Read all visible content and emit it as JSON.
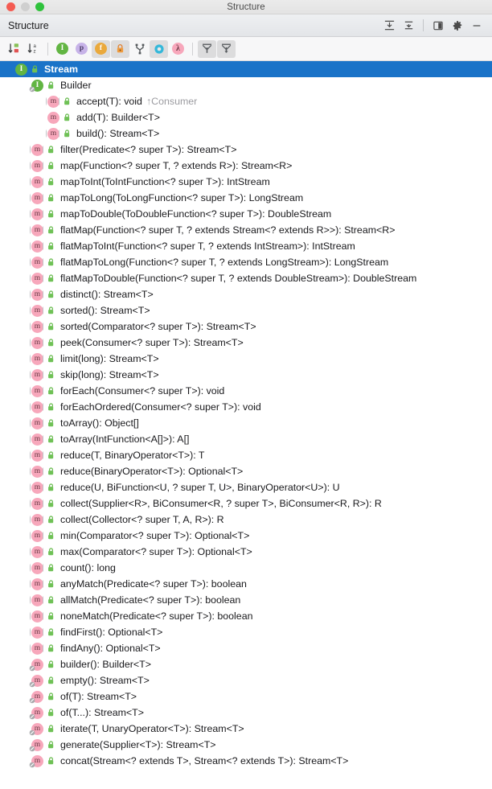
{
  "window": {
    "title": "Structure",
    "traffic_lights": [
      "close-button",
      "minimize-button",
      "zoom-button"
    ]
  },
  "panel": {
    "title": "Structure",
    "actions": [
      {
        "name": "expand-all-button",
        "icon": "expand-all-icon",
        "tooltip": "Expand All"
      },
      {
        "name": "collapse-all-button",
        "icon": "collapse-all-icon",
        "tooltip": "Collapse All"
      },
      {
        "name": "view-mode-button",
        "icon": "panel-layout-icon",
        "tooltip": "View Mode"
      },
      {
        "name": "settings-button",
        "icon": "gear-icon",
        "tooltip": "Settings"
      },
      {
        "name": "hide-button",
        "icon": "minimize-dash-icon",
        "tooltip": "Hide"
      }
    ]
  },
  "toolbar": {
    "buttons": [
      {
        "name": "sort-by-visibility-button",
        "icon": "sort-by-visibility-icon",
        "active": false
      },
      {
        "name": "sort-alphabetically-button",
        "icon": "sort-alphabetically-icon",
        "active": false
      },
      {
        "name": "show-inherited-button",
        "icon": "inherited-members-icon",
        "glyph": "I",
        "color": "#62b543",
        "active": false
      },
      {
        "name": "show-properties-button",
        "icon": "properties-icon",
        "glyph": "p",
        "color": "#b39ddb",
        "active": false
      },
      {
        "name": "show-fields-button",
        "icon": "fields-icon",
        "glyph": "f",
        "color": "#e8a33d",
        "active": true
      },
      {
        "name": "show-non-public-button",
        "icon": "lock-icon",
        "color": "#e8833a",
        "active": true
      },
      {
        "name": "group-by-implementation-button",
        "icon": "group-by-implementation-icon",
        "active": false
      },
      {
        "name": "show-interfaces-button",
        "icon": "interface-ring-icon",
        "color": "#3bb6d6",
        "active": true
      },
      {
        "name": "show-lambdas-button",
        "icon": "lambda-icon",
        "glyph": "λ",
        "color": "#f7a7bb",
        "active": false
      },
      {
        "name": "scroll-from-source-button",
        "icon": "scroll-from-source-icon",
        "active": true
      },
      {
        "name": "scroll-to-source-button",
        "icon": "scroll-to-source-icon",
        "active": true
      }
    ]
  },
  "tree": {
    "rows": [
      {
        "indent": 0,
        "twisty": "down",
        "icon": "interface-icon",
        "glyph": "I",
        "vis": "public-lock-icon",
        "label": "Stream",
        "owner": "",
        "selected": true
      },
      {
        "indent": 1,
        "twisty": "down",
        "icon": "interface-static-icon",
        "glyph": "I",
        "vis": "public-lock-icon",
        "label": "Builder",
        "owner": "",
        "selected": false
      },
      {
        "indent": 2,
        "twisty": "none",
        "icon": "method-inherited-icon",
        "glyph": "m",
        "vis": "public-lock-icon",
        "label": "accept(T): void",
        "owner": "↑Consumer",
        "selected": false
      },
      {
        "indent": 2,
        "twisty": "none",
        "icon": "method-icon",
        "glyph": "m",
        "vis": "public-lock-icon",
        "label": "add(T): Builder<T>",
        "owner": "",
        "selected": false
      },
      {
        "indent": 2,
        "twisty": "none",
        "icon": "method-inherited-icon",
        "glyph": "m",
        "vis": "public-lock-icon",
        "label": "build(): Stream<T>",
        "owner": "",
        "selected": false
      },
      {
        "indent": 1,
        "twisty": "none",
        "icon": "method-inherited-icon",
        "glyph": "m",
        "vis": "public-lock-icon",
        "label": "filter(Predicate<? super T>): Stream<T>",
        "owner": "",
        "selected": false
      },
      {
        "indent": 1,
        "twisty": "none",
        "icon": "method-inherited-icon",
        "glyph": "m",
        "vis": "public-lock-icon",
        "label": "map(Function<? super T, ? extends R>): Stream<R>",
        "owner": "",
        "selected": false
      },
      {
        "indent": 1,
        "twisty": "none",
        "icon": "method-inherited-icon",
        "glyph": "m",
        "vis": "public-lock-icon",
        "label": "mapToInt(ToIntFunction<? super T>): IntStream",
        "owner": "",
        "selected": false
      },
      {
        "indent": 1,
        "twisty": "none",
        "icon": "method-inherited-icon",
        "glyph": "m",
        "vis": "public-lock-icon",
        "label": "mapToLong(ToLongFunction<? super T>): LongStream",
        "owner": "",
        "selected": false
      },
      {
        "indent": 1,
        "twisty": "none",
        "icon": "method-inherited-icon",
        "glyph": "m",
        "vis": "public-lock-icon",
        "label": "mapToDouble(ToDoubleFunction<? super T>): DoubleStream",
        "owner": "",
        "selected": false
      },
      {
        "indent": 1,
        "twisty": "none",
        "icon": "method-inherited-icon",
        "glyph": "m",
        "vis": "public-lock-icon",
        "label": "flatMap(Function<? super T, ? extends Stream<? extends R>>): Stream<R>",
        "owner": "",
        "selected": false
      },
      {
        "indent": 1,
        "twisty": "none",
        "icon": "method-inherited-icon",
        "glyph": "m",
        "vis": "public-lock-icon",
        "label": "flatMapToInt(Function<? super T, ? extends IntStream>): IntStream",
        "owner": "",
        "selected": false
      },
      {
        "indent": 1,
        "twisty": "none",
        "icon": "method-inherited-icon",
        "glyph": "m",
        "vis": "public-lock-icon",
        "label": "flatMapToLong(Function<? super T, ? extends LongStream>): LongStream",
        "owner": "",
        "selected": false
      },
      {
        "indent": 1,
        "twisty": "none",
        "icon": "method-inherited-icon",
        "glyph": "m",
        "vis": "public-lock-icon",
        "label": "flatMapToDouble(Function<? super T, ? extends DoubleStream>): DoubleStream",
        "owner": "",
        "selected": false
      },
      {
        "indent": 1,
        "twisty": "none",
        "icon": "method-inherited-icon",
        "glyph": "m",
        "vis": "public-lock-icon",
        "label": "distinct(): Stream<T>",
        "owner": "",
        "selected": false
      },
      {
        "indent": 1,
        "twisty": "none",
        "icon": "method-inherited-icon",
        "glyph": "m",
        "vis": "public-lock-icon",
        "label": "sorted(): Stream<T>",
        "owner": "",
        "selected": false
      },
      {
        "indent": 1,
        "twisty": "none",
        "icon": "method-inherited-icon",
        "glyph": "m",
        "vis": "public-lock-icon",
        "label": "sorted(Comparator<? super T>): Stream<T>",
        "owner": "",
        "selected": false
      },
      {
        "indent": 1,
        "twisty": "none",
        "icon": "method-inherited-icon",
        "glyph": "m",
        "vis": "public-lock-icon",
        "label": "peek(Consumer<? super T>): Stream<T>",
        "owner": "",
        "selected": false
      },
      {
        "indent": 1,
        "twisty": "none",
        "icon": "method-inherited-icon",
        "glyph": "m",
        "vis": "public-lock-icon",
        "label": "limit(long): Stream<T>",
        "owner": "",
        "selected": false
      },
      {
        "indent": 1,
        "twisty": "none",
        "icon": "method-inherited-icon",
        "glyph": "m",
        "vis": "public-lock-icon",
        "label": "skip(long): Stream<T>",
        "owner": "",
        "selected": false
      },
      {
        "indent": 1,
        "twisty": "none",
        "icon": "method-inherited-icon",
        "glyph": "m",
        "vis": "public-lock-icon",
        "label": "forEach(Consumer<? super T>): void",
        "owner": "",
        "selected": false
      },
      {
        "indent": 1,
        "twisty": "none",
        "icon": "method-inherited-icon",
        "glyph": "m",
        "vis": "public-lock-icon",
        "label": "forEachOrdered(Consumer<? super T>): void",
        "owner": "",
        "selected": false
      },
      {
        "indent": 1,
        "twisty": "none",
        "icon": "method-inherited-icon",
        "glyph": "m",
        "vis": "public-lock-icon",
        "label": "toArray(): Object[]",
        "owner": "",
        "selected": false
      },
      {
        "indent": 1,
        "twisty": "none",
        "icon": "method-inherited-icon",
        "glyph": "m",
        "vis": "public-lock-icon",
        "label": "toArray(IntFunction<A[]>): A[]",
        "owner": "",
        "selected": false
      },
      {
        "indent": 1,
        "twisty": "none",
        "icon": "method-inherited-icon",
        "glyph": "m",
        "vis": "public-lock-icon",
        "label": "reduce(T, BinaryOperator<T>): T",
        "owner": "",
        "selected": false
      },
      {
        "indent": 1,
        "twisty": "none",
        "icon": "method-inherited-icon",
        "glyph": "m",
        "vis": "public-lock-icon",
        "label": "reduce(BinaryOperator<T>): Optional<T>",
        "owner": "",
        "selected": false
      },
      {
        "indent": 1,
        "twisty": "none",
        "icon": "method-inherited-icon",
        "glyph": "m",
        "vis": "public-lock-icon",
        "label": "reduce(U, BiFunction<U, ? super T, U>, BinaryOperator<U>): U",
        "owner": "",
        "selected": false
      },
      {
        "indent": 1,
        "twisty": "none",
        "icon": "method-inherited-icon",
        "glyph": "m",
        "vis": "public-lock-icon",
        "label": "collect(Supplier<R>, BiConsumer<R, ? super T>, BiConsumer<R, R>): R",
        "owner": "",
        "selected": false
      },
      {
        "indent": 1,
        "twisty": "none",
        "icon": "method-inherited-icon",
        "glyph": "m",
        "vis": "public-lock-icon",
        "label": "collect(Collector<? super T, A, R>): R",
        "owner": "",
        "selected": false
      },
      {
        "indent": 1,
        "twisty": "none",
        "icon": "method-inherited-icon",
        "glyph": "m",
        "vis": "public-lock-icon",
        "label": "min(Comparator<? super T>): Optional<T>",
        "owner": "",
        "selected": false
      },
      {
        "indent": 1,
        "twisty": "none",
        "icon": "method-inherited-icon",
        "glyph": "m",
        "vis": "public-lock-icon",
        "label": "max(Comparator<? super T>): Optional<T>",
        "owner": "",
        "selected": false
      },
      {
        "indent": 1,
        "twisty": "none",
        "icon": "method-inherited-icon",
        "glyph": "m",
        "vis": "public-lock-icon",
        "label": "count(): long",
        "owner": "",
        "selected": false
      },
      {
        "indent": 1,
        "twisty": "none",
        "icon": "method-inherited-icon",
        "glyph": "m",
        "vis": "public-lock-icon",
        "label": "anyMatch(Predicate<? super T>): boolean",
        "owner": "",
        "selected": false
      },
      {
        "indent": 1,
        "twisty": "none",
        "icon": "method-inherited-icon",
        "glyph": "m",
        "vis": "public-lock-icon",
        "label": "allMatch(Predicate<? super T>): boolean",
        "owner": "",
        "selected": false
      },
      {
        "indent": 1,
        "twisty": "none",
        "icon": "method-inherited-icon",
        "glyph": "m",
        "vis": "public-lock-icon",
        "label": "noneMatch(Predicate<? super T>): boolean",
        "owner": "",
        "selected": false
      },
      {
        "indent": 1,
        "twisty": "none",
        "icon": "method-inherited-icon",
        "glyph": "m",
        "vis": "public-lock-icon",
        "label": "findFirst(): Optional<T>",
        "owner": "",
        "selected": false
      },
      {
        "indent": 1,
        "twisty": "none",
        "icon": "method-inherited-icon",
        "glyph": "m",
        "vis": "public-lock-icon",
        "label": "findAny(): Optional<T>",
        "owner": "",
        "selected": false
      },
      {
        "indent": 1,
        "twisty": "none",
        "icon": "method-static-icon",
        "glyph": "m",
        "vis": "public-lock-icon",
        "label": "builder(): Builder<T>",
        "owner": "",
        "selected": false
      },
      {
        "indent": 1,
        "twisty": "none",
        "icon": "method-static-icon",
        "glyph": "m",
        "vis": "public-lock-icon",
        "label": "empty(): Stream<T>",
        "owner": "",
        "selected": false
      },
      {
        "indent": 1,
        "twisty": "none",
        "icon": "method-static-icon",
        "glyph": "m",
        "vis": "public-lock-icon",
        "label": "of(T): Stream<T>",
        "owner": "",
        "selected": false
      },
      {
        "indent": 1,
        "twisty": "none",
        "icon": "method-static-icon",
        "glyph": "m",
        "vis": "public-lock-icon",
        "label": "of(T...): Stream<T>",
        "owner": "",
        "selected": false
      },
      {
        "indent": 1,
        "twisty": "right",
        "icon": "method-static-icon",
        "glyph": "m",
        "vis": "public-lock-icon",
        "label": "iterate(T, UnaryOperator<T>): Stream<T>",
        "owner": "",
        "selected": false
      },
      {
        "indent": 1,
        "twisty": "none",
        "icon": "method-static-icon",
        "glyph": "m",
        "vis": "public-lock-icon",
        "label": "generate(Supplier<T>): Stream<T>",
        "owner": "",
        "selected": false
      },
      {
        "indent": 1,
        "twisty": "none",
        "icon": "method-static-icon",
        "glyph": "m",
        "vis": "public-lock-icon",
        "label": "concat(Stream<? extends T>, Stream<? extends T>): Stream<T>",
        "owner": "",
        "selected": false
      }
    ]
  },
  "colors": {
    "selection": "#1a73c8",
    "interface_green": "#62b543",
    "method_pink": "#f7a7bb",
    "owner_gray": "#9b9ba0",
    "background": "#ffffff"
  }
}
